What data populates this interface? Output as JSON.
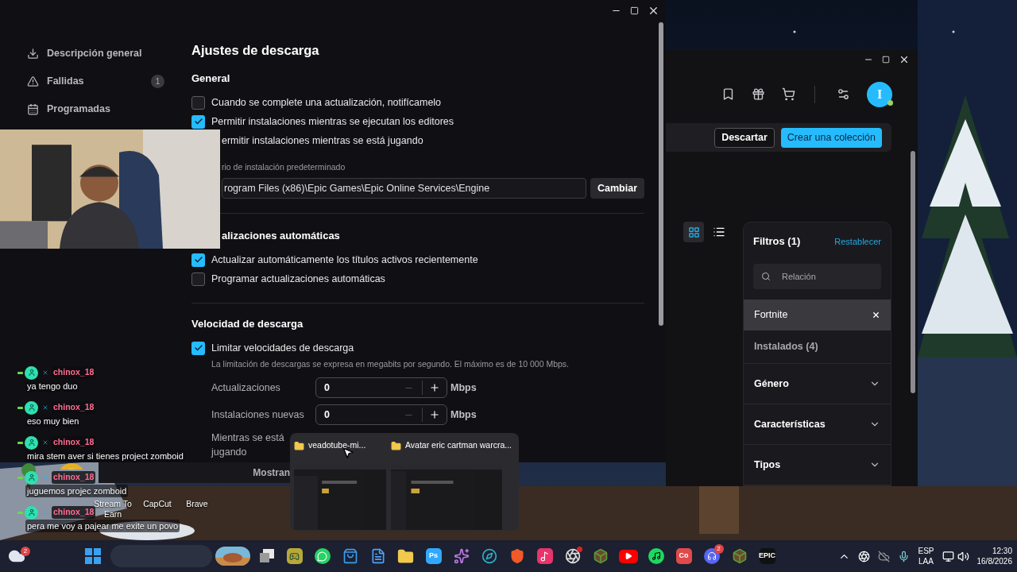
{
  "settings_window": {
    "sidebar": [
      {
        "label": "Descripción general",
        "kind": "download"
      },
      {
        "label": "Fallidas",
        "kind": "alert",
        "badge": "1"
      },
      {
        "label": "Programadas",
        "kind": "calendar"
      }
    ],
    "title": "Ajustes de descarga",
    "general": {
      "heading": "General",
      "options": [
        {
          "label": "Cuando se complete una actualización, notifícamelo",
          "checked": false
        },
        {
          "label": "Permitir instalaciones mientras se ejecutan los editores",
          "checked": true
        }
      ],
      "cut_option": "ermitir instalaciones mientras se está jugando",
      "dir_label": "rio de instalación predeterminado",
      "dir_value": "rogram Files (x86)\\Epic Games\\Epic Online Services\\Engine",
      "dir_button": "Cambiar"
    },
    "auto": {
      "heading": "alizaciones automáticas",
      "options": [
        {
          "label": "Actualizar automáticamente los títulos activos recientemente",
          "checked": true
        },
        {
          "label": "Programar actualizaciones automáticas",
          "checked": false
        }
      ]
    },
    "speed": {
      "heading": "Velocidad de descarga",
      "option": {
        "label": "Limitar velocidades de descarga",
        "checked": true
      },
      "note": "La limitación de descargas se expresa en megabits por segundo. El máximo es de 10 000 Mbps.",
      "limits": [
        {
          "label": "Actualizaciones",
          "value": "0",
          "unit": "Mbps"
        },
        {
          "label": "Instalaciones nuevas",
          "value": "0",
          "unit": "Mbps"
        }
      ],
      "cut_label": "Mientras se está jugando"
    }
  },
  "under_text": "Mostran",
  "epic_window": {
    "avatar": "I",
    "buttons": [
      {
        "label": "Descartar",
        "kind": "outline"
      },
      {
        "label": "Crear una colección",
        "kind": "primary"
      }
    ],
    "views": [
      {
        "kind": "grid",
        "selected": true
      },
      {
        "kind": "list",
        "selected": false
      }
    ],
    "filters": {
      "title": "Filtros (1)",
      "reset": "Restablecer",
      "search_placeholder": "Relación",
      "items": [
        {
          "label": "Fortnite",
          "kind": "tag"
        },
        {
          "label": "Instalados (4)",
          "kind": "toggle"
        },
        {
          "label": "Género",
          "kind": "group"
        },
        {
          "label": "Características",
          "kind": "group"
        },
        {
          "label": "Tipos",
          "kind": "group"
        }
      ]
    }
  },
  "desktop_icons": [
    {
      "kind": "tree"
    },
    {
      "kind": "coin",
      "label": "Stream To Earn"
    },
    {
      "kind": "none",
      "label": "CapCut"
    },
    {
      "kind": "none",
      "label": "Brave"
    }
  ],
  "chat": [
    {
      "user": "chinox_18",
      "text": "ya tengo duo"
    },
    {
      "user": "chinox_18",
      "text": "eso muy bien"
    },
    {
      "user": "chinox_18",
      "text": "mira stem aver si tienes project zomboid"
    },
    {
      "user": "chinox_18",
      "text": "juguemos projec zomboid"
    },
    {
      "user": "chinox_18",
      "text": "pera me voy a pajear me exite un povo"
    }
  ],
  "task_preview": [
    {
      "title": "veadotube-mi..."
    },
    {
      "title": "Avatar eric cartman warcra..."
    }
  ],
  "taskbar": {
    "weather_badge": "2",
    "apps": [
      {
        "kind": "game"
      },
      {
        "kind": "whatsapp"
      },
      {
        "kind": "store"
      },
      {
        "kind": "files"
      },
      {
        "kind": "folder"
      },
      {
        "kind": "text",
        "text": "Ps",
        "color": "#31a8ff"
      },
      {
        "kind": "copilot"
      },
      {
        "kind": "edge"
      },
      {
        "kind": "brave"
      },
      {
        "kind": "tiktok"
      },
      {
        "kind": "obs"
      },
      {
        "kind": "minecraft"
      },
      {
        "kind": "youtube"
      },
      {
        "kind": "spotify"
      },
      {
        "kind": "text",
        "text": "Co",
        "color": "#e04a4a"
      },
      {
        "kind": "discord",
        "badge": "2"
      },
      {
        "kind": "minecraft"
      },
      {
        "kind": "text",
        "text": "EPIC",
        "color": "#111111"
      }
    ],
    "lang": [
      "ESP",
      "LAA"
    ],
    "time": "12:30",
    "date": "16/8/2026"
  }
}
